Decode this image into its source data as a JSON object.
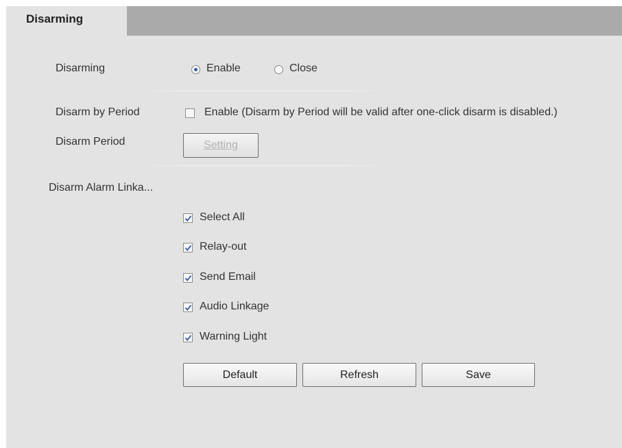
{
  "tab": {
    "label": "Disarming"
  },
  "disarming": {
    "label": "Disarming",
    "options": [
      {
        "label": "Enable",
        "selected": true
      },
      {
        "label": "Close",
        "selected": false
      }
    ]
  },
  "disarm_by_period": {
    "label": "Disarm by Period",
    "checkbox_label": "Enable (Disarm by Period will be valid after one-click disarm is disabled.)",
    "checked": false
  },
  "disarm_period": {
    "label": "Disarm Period",
    "button_label": "Setting",
    "button_enabled": false
  },
  "alarm_linkage": {
    "label": "Disarm Alarm Linka...",
    "items": [
      {
        "label": "Select All",
        "checked": true
      },
      {
        "label": "Relay-out",
        "checked": true
      },
      {
        "label": "Send Email",
        "checked": true
      },
      {
        "label": "Audio Linkage",
        "checked": true
      },
      {
        "label": "Warning Light",
        "checked": true
      }
    ]
  },
  "buttons": {
    "default": "Default",
    "refresh": "Refresh",
    "save": "Save"
  },
  "colors": {
    "panel_bg": "#e3e3e3",
    "tab_strip": "#aaaaaa",
    "check_mark": "#2a5fb0"
  }
}
